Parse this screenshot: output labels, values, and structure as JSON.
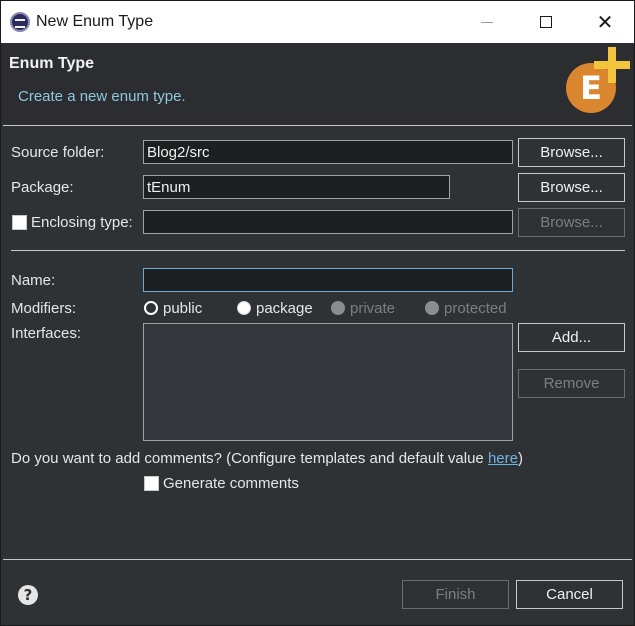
{
  "window": {
    "title": "New Enum Type"
  },
  "header": {
    "title": "Enum Type",
    "description": "Create a new enum type.",
    "icon": "enum-new-icon"
  },
  "source_folder": {
    "label": "Source folder:",
    "value": "Blog2/src",
    "browse_label": "Browse..."
  },
  "package": {
    "label": "Package:",
    "value": "tEnum",
    "browse_label": "Browse..."
  },
  "enclosing_type": {
    "label": "Enclosing type:",
    "checked": false,
    "value": "",
    "browse_label": "Browse..."
  },
  "name": {
    "label": "Name:",
    "value": ""
  },
  "modifiers": {
    "label": "Modifiers:",
    "options": [
      {
        "label": "public",
        "selected": true,
        "enabled": true
      },
      {
        "label": "package",
        "selected": false,
        "enabled": true
      },
      {
        "label": "private",
        "selected": false,
        "enabled": false
      },
      {
        "label": "protected",
        "selected": false,
        "enabled": false
      }
    ]
  },
  "interfaces": {
    "label": "Interfaces:",
    "add_label": "Add...",
    "remove_label": "Remove"
  },
  "comments": {
    "question": "Do you want to add comments? (Configure templates and default value ",
    "link": "here",
    "question_end": ")",
    "generate_label": "Generate comments",
    "generate_checked": false
  },
  "footer": {
    "finish_label": "Finish",
    "cancel_label": "Cancel"
  }
}
